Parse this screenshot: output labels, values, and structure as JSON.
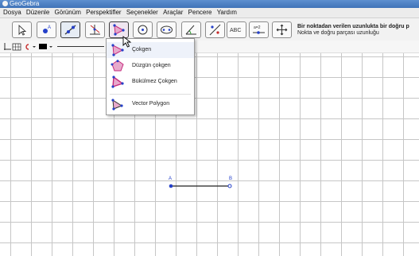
{
  "window": {
    "title": "GeoGebra"
  },
  "menubar": {
    "items": [
      "Dosya",
      "Düzenle",
      "Görünüm",
      "Perspektifler",
      "Seçenekler",
      "Araçlar",
      "Pencere",
      "Yardım"
    ]
  },
  "toolbar": {
    "tools": [
      "move",
      "point",
      "line",
      "perpendicular",
      "polygon",
      "circle",
      "conic",
      "angle",
      "reflect",
      "text",
      "slider",
      "move-graphics"
    ],
    "selected_tool": "line",
    "text_tool_label": "ABC",
    "slider_tool_label": "a=2",
    "help_title": "Bir noktadan verilen uzunlukta bir doğru p",
    "help_subtitle": "Nokta ve doğru parçası uzunluğu"
  },
  "polygon_menu": {
    "items": [
      {
        "label": "Çokgen",
        "icon": "polygon-icon"
      },
      {
        "label": "Düzgün çokgen",
        "icon": "regular-polygon-icon"
      },
      {
        "label": "Bükülmez Çokgen",
        "icon": "rigid-polygon-icon"
      },
      {
        "label": "Vector Polygon",
        "icon": "vector-polygon-icon"
      }
    ]
  },
  "graphics": {
    "points": [
      {
        "label": "A"
      },
      {
        "label": "B"
      }
    ]
  },
  "colors": {
    "accent": "#2540c9",
    "menu_icon": "#c62a7d",
    "titlebar": "#4a7fc4"
  }
}
